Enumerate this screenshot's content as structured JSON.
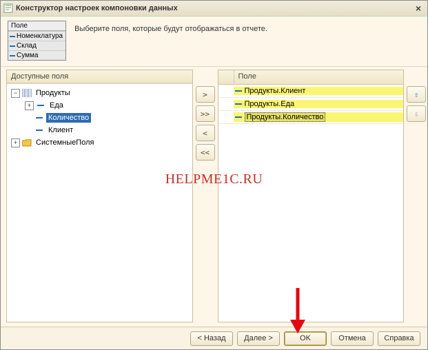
{
  "title": "Конструктор настроек компоновки данных",
  "instruction": "Выберите поля, которые будут отображаться в отчете.",
  "fieldbox": {
    "header": "Поле",
    "rows": [
      "Номенклатура",
      "Склад",
      "Сумма"
    ]
  },
  "leftPanel": {
    "header": "Доступные поля",
    "tree": {
      "root": {
        "label": "Продукты"
      },
      "children": [
        {
          "label": "Еда"
        },
        {
          "label": "Количество",
          "selected": true
        },
        {
          "label": "Клиент"
        }
      ],
      "system": {
        "label": "СистемныеПоля"
      }
    }
  },
  "rightPanel": {
    "header": "Поле",
    "rows": [
      {
        "label": "Продукты.Клиент"
      },
      {
        "label": "Продукты.Еда"
      },
      {
        "label": "Продукты.Количество",
        "selected": true
      }
    ]
  },
  "moveButtons": {
    "add": ">",
    "addAll": ">>",
    "remove": "<",
    "removeAll": "<<"
  },
  "orderButtons": {
    "up": "⇧",
    "down": "⇩"
  },
  "footer": {
    "back": "< Назад",
    "next": "Далее >",
    "ok": "OK",
    "cancel": "Отмена",
    "help": "Справка"
  },
  "watermark": "HELPME1C.RU"
}
